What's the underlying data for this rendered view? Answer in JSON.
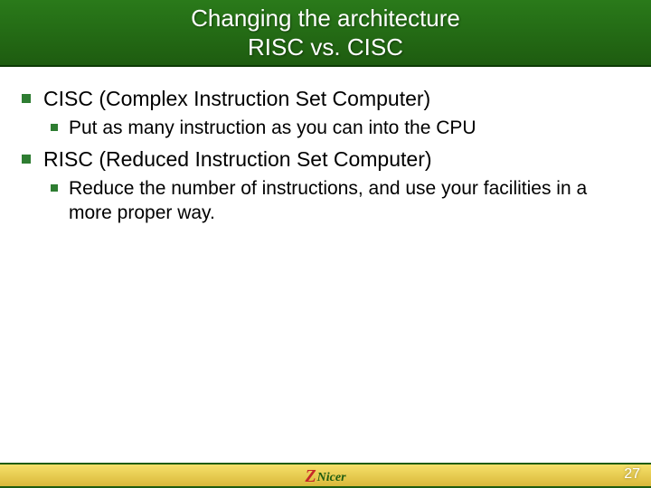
{
  "title": {
    "line1": "Changing the architecture",
    "line2": "RISC vs. CISC"
  },
  "items": [
    {
      "text": "CISC (Complex Instruction Set Computer)",
      "sub": [
        {
          "text": "Put as many instruction as you can into the CPU"
        }
      ]
    },
    {
      "text": "RISC (Reduced Instruction Set Computer)",
      "sub": [
        {
          "text": "Reduce the number of instructions, and use your facilities in a more proper way."
        }
      ]
    }
  ],
  "footer": {
    "page": "27",
    "logo_z": "Z",
    "logo_nicer": "Nicer"
  }
}
